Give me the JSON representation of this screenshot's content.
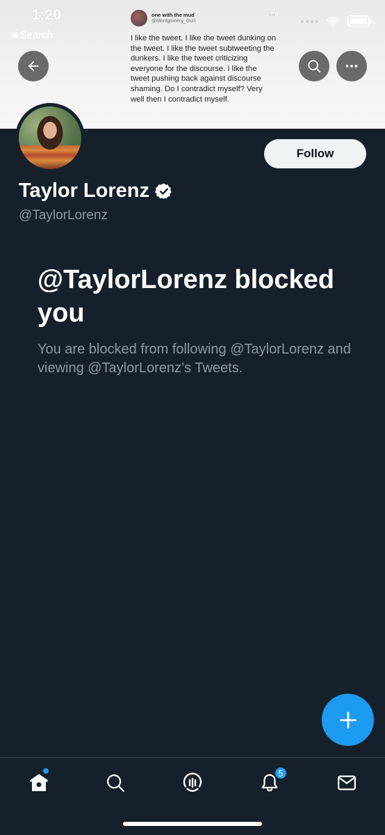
{
  "status_bar": {
    "time": "1:20",
    "back_label": "Search"
  },
  "banner_tweet": {
    "author_name": "one with the mud",
    "author_handle": "@Montgomery_Gurl",
    "more": "···",
    "text": "I like the tweet. I like the tweet dunking on the tweet. I like the tweet subtweeting the dunkers. I like the tweet criticizing everyone for the discourse. I like the tweet pushing back against discourse shaming. Do I contradict myself? Very well then I contradict myself."
  },
  "profile": {
    "display_name": "Taylor Lorenz",
    "username": "@TaylorLorenz",
    "verified": true,
    "follow_label": "Follow"
  },
  "blocked": {
    "title": "@TaylorLorenz blocked you",
    "description": "You are blocked from following @TaylorLorenz and viewing @TaylorLorenz’s Tweets."
  },
  "tabbar": {
    "notifications_badge": "5",
    "items": [
      "home-icon",
      "search-icon",
      "spaces-icon",
      "bell-icon",
      "mail-icon"
    ]
  },
  "colors": {
    "background": "#15202b",
    "accent": "#1d9bf0",
    "secondary_text": "#8b98a5"
  }
}
